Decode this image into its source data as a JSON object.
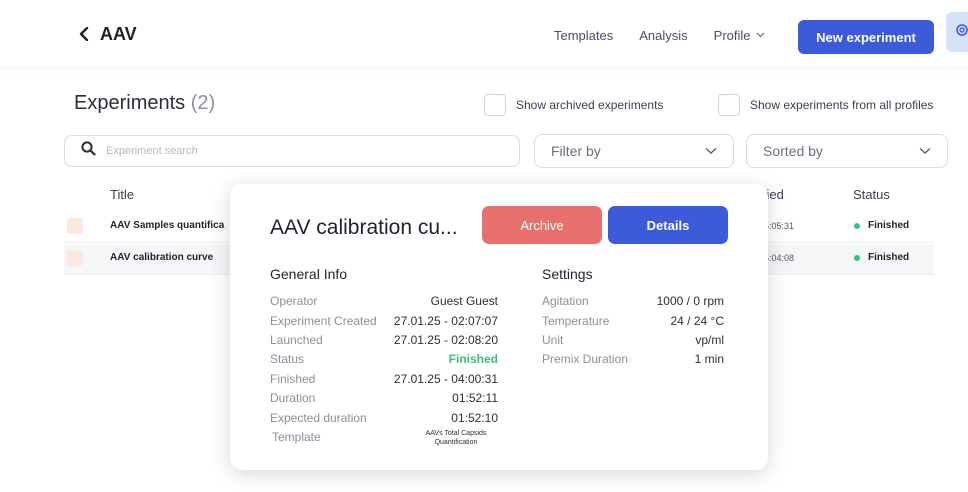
{
  "header": {
    "back_title": "AAV",
    "nav": {
      "templates": "Templates",
      "analysis": "Analysis",
      "profile": "Profile"
    },
    "new_experiment": "New experiment"
  },
  "experiments": {
    "title": "Experiments",
    "count": "(2)",
    "show_archived": "Show archived experiments",
    "show_all_profiles": "Show experiments from all profiles",
    "search_placeholder": "Experiment search",
    "filter_label": "Filter by",
    "sort_label": "Sorted by",
    "columns": {
      "title": "Title",
      "modified": "ified",
      "status": "Status"
    },
    "rows": [
      {
        "name": "AAV  Samples quantifica",
        "time": "5:05:31",
        "status": "Finished"
      },
      {
        "name": "AAV  calibration curve",
        "time": "5:04:08",
        "status": "Finished"
      }
    ]
  },
  "popup": {
    "title": "AAV   calibration cu...",
    "archive": "Archive",
    "details": "Details",
    "general_info": {
      "heading": "General Info",
      "items": [
        {
          "label": "Operator",
          "value": "Guest Guest"
        },
        {
          "label": "Experiment Created",
          "value": "27.01.25 - 02:07:07"
        },
        {
          "label": "Launched",
          "value": "27.01.25 - 02:08:20"
        },
        {
          "label": "Status",
          "value": "Finished"
        },
        {
          "label": "Finished",
          "value": "27.01.25 - 04:00:31"
        },
        {
          "label": "Duration",
          "value": "01:52:11"
        },
        {
          "label": "Expected duration",
          "value": "01:52:10"
        },
        {
          "label": "Template",
          "value": "AAVs Total Capsids Quantification"
        }
      ]
    },
    "settings": {
      "heading": "Settings",
      "items": [
        {
          "label": "Agitation",
          "value": "1000 / 0 rpm"
        },
        {
          "label": "Temperature",
          "value": "24 / 24 °C"
        },
        {
          "label": "Unit",
          "value": "vp/ml"
        },
        {
          "label": "Premix Duration",
          "value": "1 min"
        }
      ]
    }
  },
  "colors": {
    "primary": "#3b5bdb",
    "archive": "#e8716d",
    "finished": "#3cbf7a"
  },
  "icons": [
    "chevron-left-icon",
    "chevron-down-icon",
    "gear-icon",
    "search-icon",
    "status-dot-icon"
  ]
}
